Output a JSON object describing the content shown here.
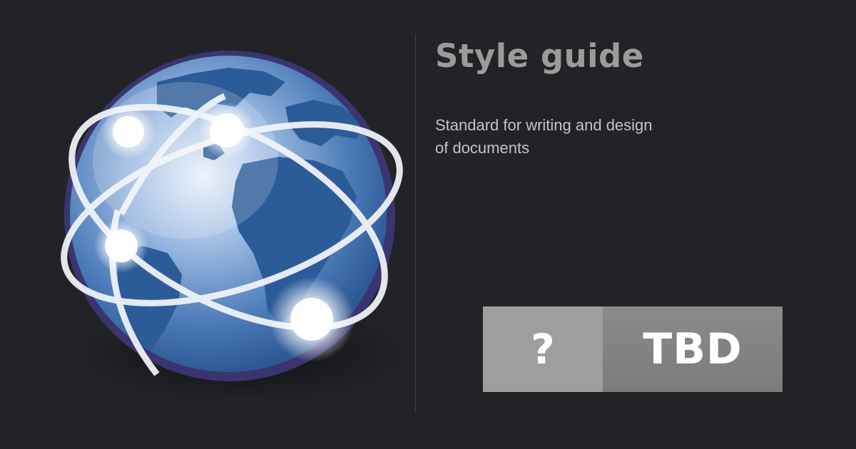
{
  "title": "Style guide",
  "subtitle_lines": [
    "Standard for writing and design",
    "of documents"
  ],
  "badge": {
    "label": "?",
    "status": "TBD",
    "label_bg": "#9e9e9e",
    "status_bg": "#808080"
  },
  "colors": {
    "background": "#212327",
    "title": "#9b9b9b",
    "subtitle": "#c2c4c8",
    "globe_ocean": "#3f6eaa",
    "globe_land": "#2a5a96",
    "globe_rim": "#3a3570"
  },
  "illustration": {
    "icon": "network-globe-icon"
  }
}
